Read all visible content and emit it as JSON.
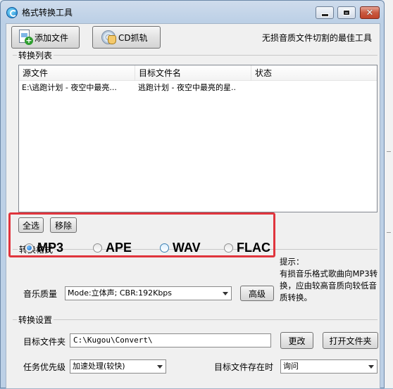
{
  "window": {
    "title": "格式转换工具"
  },
  "toolbar": {
    "add_file_label": "添加文件",
    "cd_rip_label": "CD抓轨",
    "slogan": "无损音质文件切割的最佳工具"
  },
  "conversion_list": {
    "group_label": "转换列表",
    "columns": [
      "源文件",
      "目标文件名",
      "状态"
    ],
    "rows": [
      {
        "source": "E:\\逃跑计划 - 夜空中最亮...",
        "target": "逃跑计划 - 夜空中最亮的星..",
        "status": ""
      }
    ],
    "select_all_label": "全选",
    "remove_label": "移除"
  },
  "format": {
    "group_label": "转换格式",
    "options": [
      "MP3",
      "APE",
      "WAV",
      "FLAC"
    ],
    "selected": "MP3",
    "tip_text": "提示：\n有损音乐格式歌曲向MP3转换，应由较高音质向较低音质转换。"
  },
  "quality": {
    "label": "音乐质量",
    "value": "Mode:立体声; CBR:192Kbps",
    "advanced_label": "高级"
  },
  "settings": {
    "group_label": "转换设置",
    "target_folder_label": "目标文件夹",
    "target_folder_value": "C:\\Kugou\\Convert\\",
    "change_label": "更改",
    "open_folder_label": "打开文件夹",
    "priority_label": "任务优先级",
    "priority_value": "加速处理(较快)",
    "exists_label": "目标文件存在时",
    "exists_value": "询问"
  },
  "colors": {
    "highlight_border": "#e0353d",
    "title_bar": "#bcd0e6",
    "client_bg": "#f0f0f0"
  }
}
